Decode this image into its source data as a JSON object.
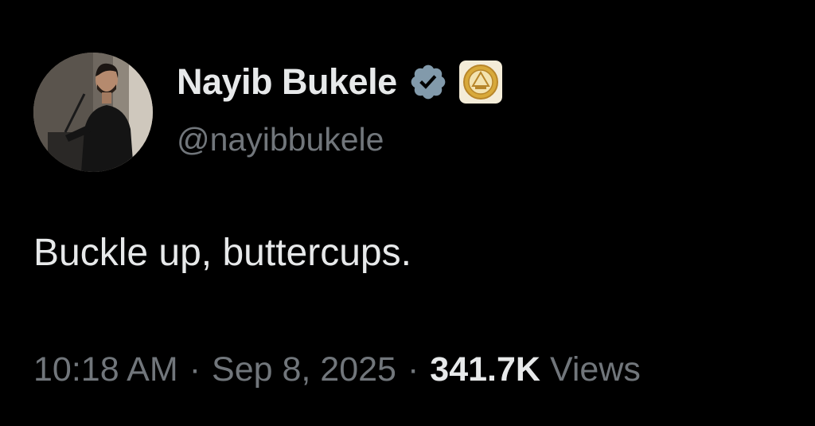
{
  "author": {
    "display_name": "Nayib Bukele",
    "handle": "@nayibbukele",
    "verified_badge_icon": "verified-checkmark-icon",
    "verified_badge_color": "#829aab",
    "affiliation_badge_icon": "government-seal-icon",
    "avatar": "profile-photo"
  },
  "tweet": {
    "text": "Buckle up, buttercups."
  },
  "meta": {
    "time": "10:18 AM",
    "separator": "·",
    "date": "Sep 8, 2025",
    "views_count": "341.7K",
    "views_label": "Views"
  },
  "colors": {
    "background": "#000000",
    "primary_text": "#e7e9ea",
    "secondary_text": "#71767b"
  }
}
